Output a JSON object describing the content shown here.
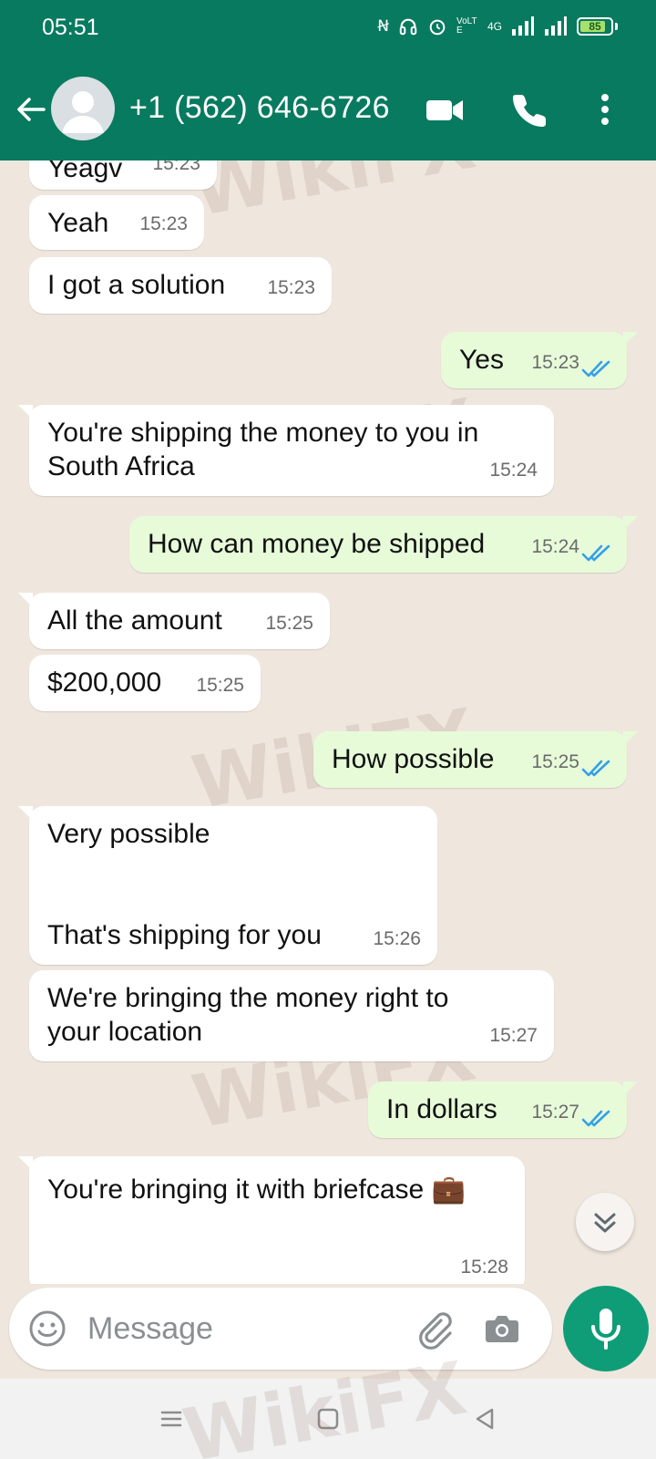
{
  "status_bar": {
    "time": "05:51",
    "network": "4G",
    "volte": "VoLTE",
    "battery_level": "85",
    "battery_fraction": 0.85
  },
  "header": {
    "contact_name": "+1 (562) 646-6726",
    "icons": [
      "back-arrow-icon",
      "video-call-icon",
      "voice-call-icon",
      "more-options-icon"
    ]
  },
  "messages": [
    {
      "dir": "in",
      "text": "Yeagv",
      "time": "15:23"
    },
    {
      "dir": "in",
      "text": "Yeah",
      "time": "15:23"
    },
    {
      "dir": "in",
      "text": "I got a solution",
      "time": "15:23"
    },
    {
      "dir": "out",
      "text": "Yes",
      "time": "15:23",
      "status": "read"
    },
    {
      "dir": "in",
      "text": "You're shipping the money to you in South Africa",
      "time": "15:24"
    },
    {
      "dir": "out",
      "text": "How can money be shipped",
      "time": "15:24",
      "status": "read"
    },
    {
      "dir": "in",
      "text": "All the amount",
      "time": "15:25"
    },
    {
      "dir": "in",
      "text": "$200,000",
      "time": "15:25"
    },
    {
      "dir": "out",
      "text": "How possible",
      "time": "15:25",
      "status": "read"
    },
    {
      "dir": "in",
      "text": "Very possible\n\n\nThat's shipping for you",
      "time": "15:26"
    },
    {
      "dir": "in",
      "text": "We're bringing the money  right to your location",
      "time": "15:27"
    },
    {
      "dir": "out",
      "text": "In dollars",
      "time": "15:27",
      "status": "read"
    },
    {
      "dir": "in",
      "text": "You're bringing it with briefcase 💼",
      "time": "15:28"
    }
  ],
  "composer": {
    "placeholder": "Message"
  },
  "watermark": "WikiFX",
  "colors": {
    "header": "#077a5f",
    "chat_bg": "#efe7de",
    "outgoing_bubble": "#e7fbd9",
    "incoming_bubble": "#ffffff",
    "read_ticks": "#34a0e8",
    "mic_button": "#0f9d78"
  }
}
